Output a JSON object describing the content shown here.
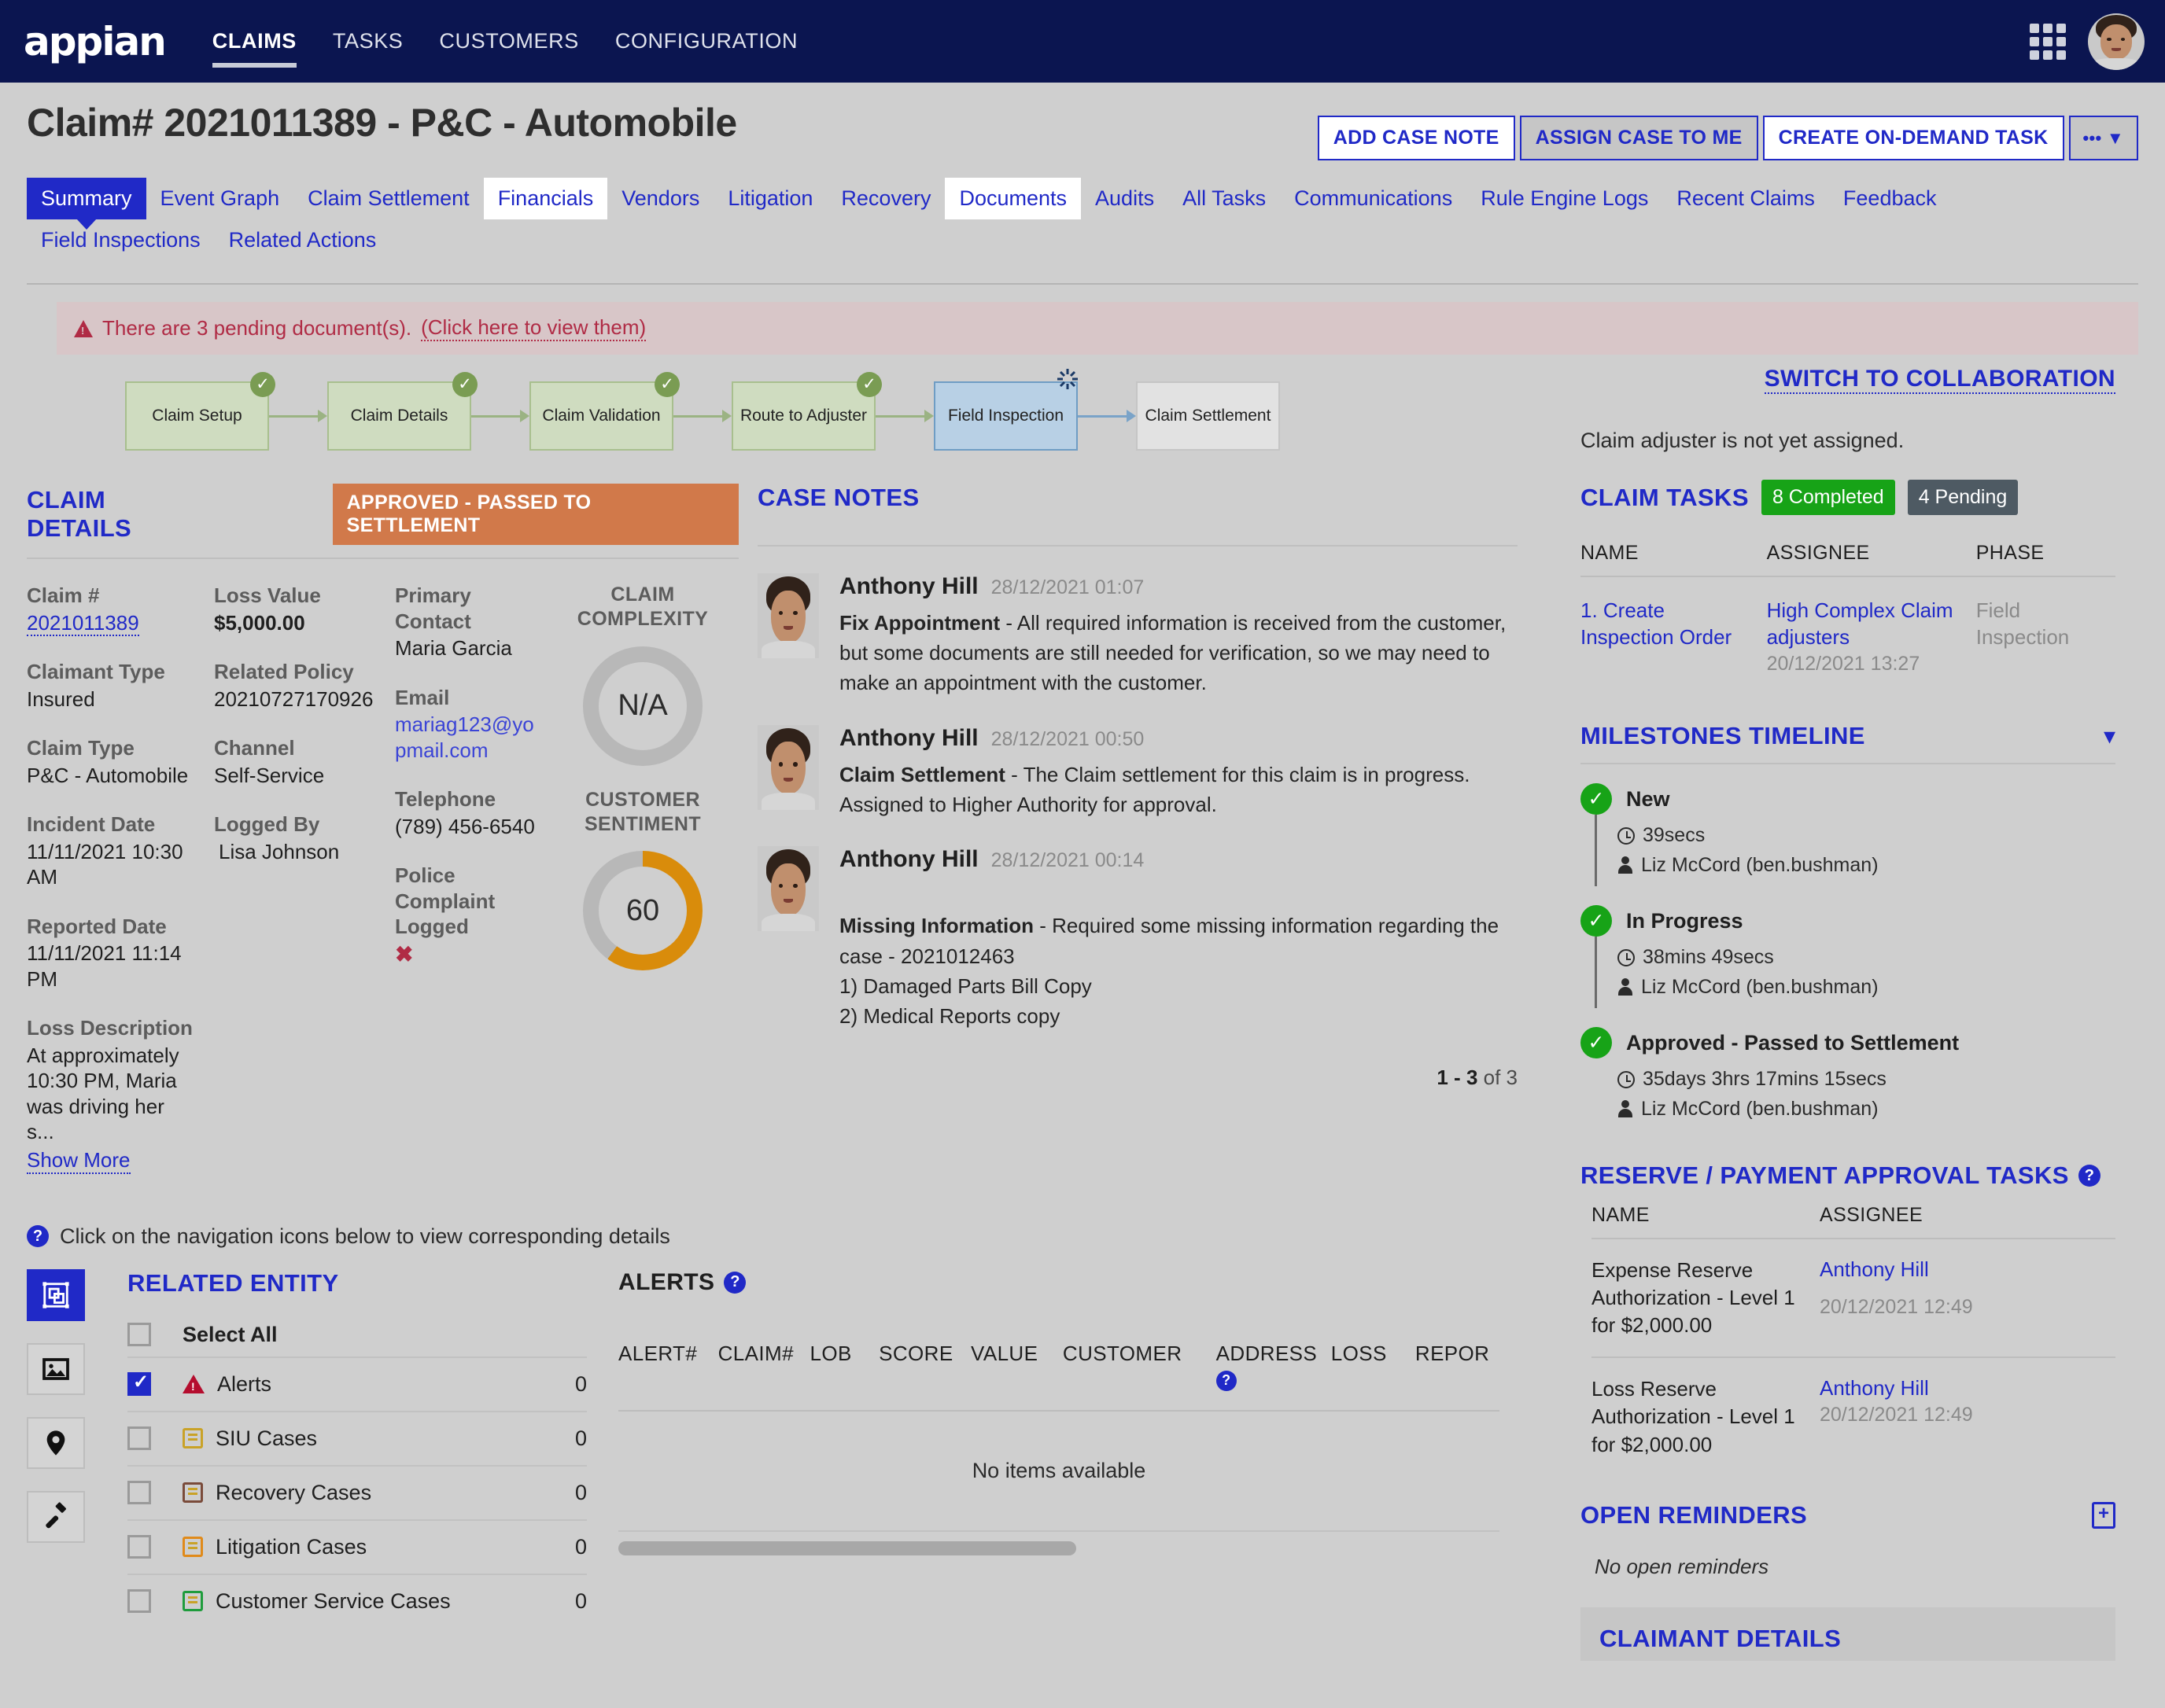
{
  "brand": {
    "logo_text": "appian",
    "accent": "#2029c7",
    "navy": "#0b1550"
  },
  "topnav": {
    "items": [
      {
        "label": "CLAIMS",
        "active": true
      },
      {
        "label": "TASKS",
        "active": false
      },
      {
        "label": "CUSTOMERS",
        "active": false
      },
      {
        "label": "CONFIGURATION",
        "active": false
      }
    ],
    "grid_icon": "apps-grid-icon",
    "avatar": "user-avatar"
  },
  "header": {
    "title": "Claim# 2021011389 - P&C - Automobile",
    "actions": [
      {
        "label": "ADD CASE NOTE",
        "style": "white"
      },
      {
        "label": "ASSIGN CASE TO ME",
        "style": "grey"
      },
      {
        "label": "CREATE ON-DEMAND TASK",
        "style": "white"
      },
      {
        "label": "••• ▼",
        "style": "grey"
      }
    ]
  },
  "tabs": [
    {
      "label": "Summary",
      "state": "active"
    },
    {
      "label": "Event Graph",
      "state": "normal"
    },
    {
      "label": "Claim Settlement",
      "state": "normal"
    },
    {
      "label": "Financials",
      "state": "white"
    },
    {
      "label": "Vendors",
      "state": "normal"
    },
    {
      "label": "Litigation",
      "state": "normal"
    },
    {
      "label": "Recovery",
      "state": "normal"
    },
    {
      "label": "Documents",
      "state": "white"
    },
    {
      "label": "Audits",
      "state": "normal"
    },
    {
      "label": "All Tasks",
      "state": "normal"
    },
    {
      "label": "Communications",
      "state": "normal"
    },
    {
      "label": "Rule Engine Logs",
      "state": "normal"
    },
    {
      "label": "Recent Claims",
      "state": "normal"
    },
    {
      "label": "Feedback",
      "state": "normal"
    },
    {
      "label": "Field Inspections",
      "state": "normal"
    },
    {
      "label": "Related Actions",
      "state": "normal"
    }
  ],
  "banner": {
    "icon": "warning-triangle-icon",
    "text": "There are 3 pending document(s).",
    "link": "(Click here to view them)"
  },
  "workflow": {
    "nodes": [
      {
        "label": "Claim Setup",
        "state": "done"
      },
      {
        "label": "Claim Details",
        "state": "done"
      },
      {
        "label": "Claim Validation",
        "state": "done"
      },
      {
        "label": "Route to Adjuster",
        "state": "done"
      },
      {
        "label": "Field Inspection",
        "state": "current"
      },
      {
        "label": "Claim Settlement",
        "state": "pending"
      }
    ]
  },
  "claim_details": {
    "title": "CLAIM DETAILS",
    "status_pill": "APPROVED - PASSED TO SETTLEMENT",
    "fields_col1": [
      {
        "label": "Claim #",
        "value": "2021011389",
        "kind": "link"
      },
      {
        "label": "Claimant Type",
        "value": "Insured",
        "kind": "text"
      },
      {
        "label": "Claim Type",
        "value": "P&C - Automobile",
        "kind": "text"
      },
      {
        "label": "Incident Date",
        "value": "11/11/2021 10:30 AM",
        "kind": "text"
      },
      {
        "label": "Reported Date",
        "value": "11/11/2021 11:14 PM",
        "kind": "text"
      },
      {
        "label": "Loss Description",
        "value": "At approximately 10:30 PM, Maria was driving her s...",
        "kind": "text",
        "more": "Show More"
      }
    ],
    "fields_col2": [
      {
        "label": "Loss Value",
        "value": "$5,000.00",
        "kind": "bold"
      },
      {
        "label": "Related Policy",
        "value": "20210727170926",
        "kind": "text"
      },
      {
        "label": "Channel",
        "value": "Self-Service",
        "kind": "text"
      },
      {
        "label": "Logged By",
        "value": "Lisa Johnson",
        "kind": "text"
      }
    ],
    "fields_col3": [
      {
        "label": "Primary Contact",
        "value": "Maria Garcia",
        "kind": "text"
      },
      {
        "label": "Email",
        "value": "mariag123@yopmail.com",
        "kind": "mail"
      },
      {
        "label": "Telephone",
        "value": "(789) 456-6540",
        "kind": "text"
      },
      {
        "label": "Police Complaint Logged",
        "value": "✖",
        "kind": "xmark"
      }
    ],
    "gauges": [
      {
        "title": "CLAIM COMPLEXITY",
        "value": "N/A",
        "percent": 0,
        "color": "#b8b8b8"
      },
      {
        "title": "CUSTOMER SENTIMENT",
        "value": "60",
        "percent": 60,
        "color": "#d98c0b"
      }
    ]
  },
  "case_notes": {
    "title": "CASE NOTES",
    "notes": [
      {
        "author": "Anthony Hill",
        "time": "28/12/2021 01:07",
        "subject": "Fix Appointment",
        "body": " - All required information is received from the customer, but some documents are still needed for verification, so we may need to make an appointment with the customer."
      },
      {
        "author": "Anthony Hill",
        "time": "28/12/2021 00:50",
        "subject": "Claim Settlement",
        "body": " - The Claim settlement for this claim is in progress. Assigned to Higher Authority for approval."
      },
      {
        "author": "Anthony Hill",
        "time": "28/12/2021 00:14",
        "subject": "Missing Information",
        "body": " - Required some missing information regarding the case - 2021012463\n1) Damaged Parts Bill Copy\n2) Medical Reports copy"
      }
    ],
    "pager_bold": "1 - 3",
    "pager_rest": " of 3"
  },
  "sidebar": {
    "switch_collaboration": "SWITCH TO COLLABORATION",
    "adjuster_note": "Claim adjuster is not yet assigned.",
    "claim_tasks": {
      "title": "CLAIM TASKS",
      "completed_badge": "8 Completed",
      "pending_badge": "4 Pending",
      "columns": [
        "NAME",
        "ASSIGNEE",
        "PHASE"
      ],
      "rows": [
        {
          "name": "1. Create Inspection Order",
          "assignee": "High Complex Claim adjusters",
          "assignee_time": "20/12/2021 13:27",
          "phase": "Field Inspection"
        }
      ]
    },
    "milestones": {
      "title": "MILESTONES TIMELINE",
      "collapse_icon": "chevron-down-icon",
      "items": [
        {
          "name": "New",
          "duration": "39secs",
          "user": "Liz McCord (ben.bushman)"
        },
        {
          "name": "In Progress",
          "duration": "38mins 49secs",
          "user": "Liz McCord (ben.bushman)"
        },
        {
          "name": "Approved - Passed to Settlement",
          "duration": "35days 3hrs 17mins 15secs",
          "user": "Liz McCord (ben.bushman)"
        }
      ]
    },
    "reserve_tasks": {
      "title": "RESERVE / PAYMENT APPROVAL TASKS",
      "help_icon": "help-circle-icon",
      "columns": [
        "NAME",
        "ASSIGNEE"
      ],
      "rows": [
        {
          "name": "Expense Reserve Authorization - Level 1 for $2,000.00",
          "assignee": "Anthony Hill",
          "time": "20/12/2021 12:49"
        },
        {
          "name": "Loss Reserve Authorization - Level 1 for $2,000.00",
          "assignee": "Anthony Hill",
          "time": "20/12/2021 12:49"
        }
      ]
    },
    "open_reminders": {
      "title": "OPEN REMINDERS",
      "add_icon": "calendar-plus-icon",
      "empty_text": "No open reminders"
    },
    "claimant_details": {
      "title": "CLAIMANT DETAILS"
    }
  },
  "bottom": {
    "hint_icon": "help-circle-icon",
    "hint": "Click on the navigation icons below to view corresponding details",
    "nav_icons": [
      {
        "name": "related-entity-icon",
        "selected": true
      },
      {
        "name": "image-icon",
        "selected": false
      },
      {
        "name": "map-pin-icon",
        "selected": false
      },
      {
        "name": "gavel-icon",
        "selected": false
      }
    ],
    "related_entity": {
      "title": "RELATED ENTITY",
      "select_all": "Select All",
      "select_all_checked": false,
      "items": [
        {
          "label": "Alerts",
          "count": "0",
          "checked": true,
          "icon": "alert-triangle-icon",
          "color": "#b50d2e"
        },
        {
          "label": "SIU Cases",
          "count": "0",
          "checked": false,
          "icon": "list-icon",
          "color": "#c9a227"
        },
        {
          "label": "Recovery Cases",
          "count": "0",
          "checked": false,
          "icon": "list-icon",
          "color": "#7a4b3a"
        },
        {
          "label": "Litigation Cases",
          "count": "0",
          "checked": false,
          "icon": "list-icon",
          "color": "#e08a1a"
        },
        {
          "label": "Customer Service Cases",
          "count": "0",
          "checked": false,
          "icon": "list-icon",
          "color": "#1f9c3c"
        }
      ]
    },
    "alerts_table": {
      "title": "ALERTS",
      "help_icon": "help-circle-icon",
      "columns": [
        "ALERT#",
        "CLAIM#",
        "LOB",
        "SCORE",
        "VALUE",
        "CUSTOMER",
        "ADDRESS",
        "LOSS",
        "REPOR"
      ],
      "address_has_help": true,
      "empty_text": "No items available",
      "scrollbar": "horizontal-scrollbar"
    }
  }
}
